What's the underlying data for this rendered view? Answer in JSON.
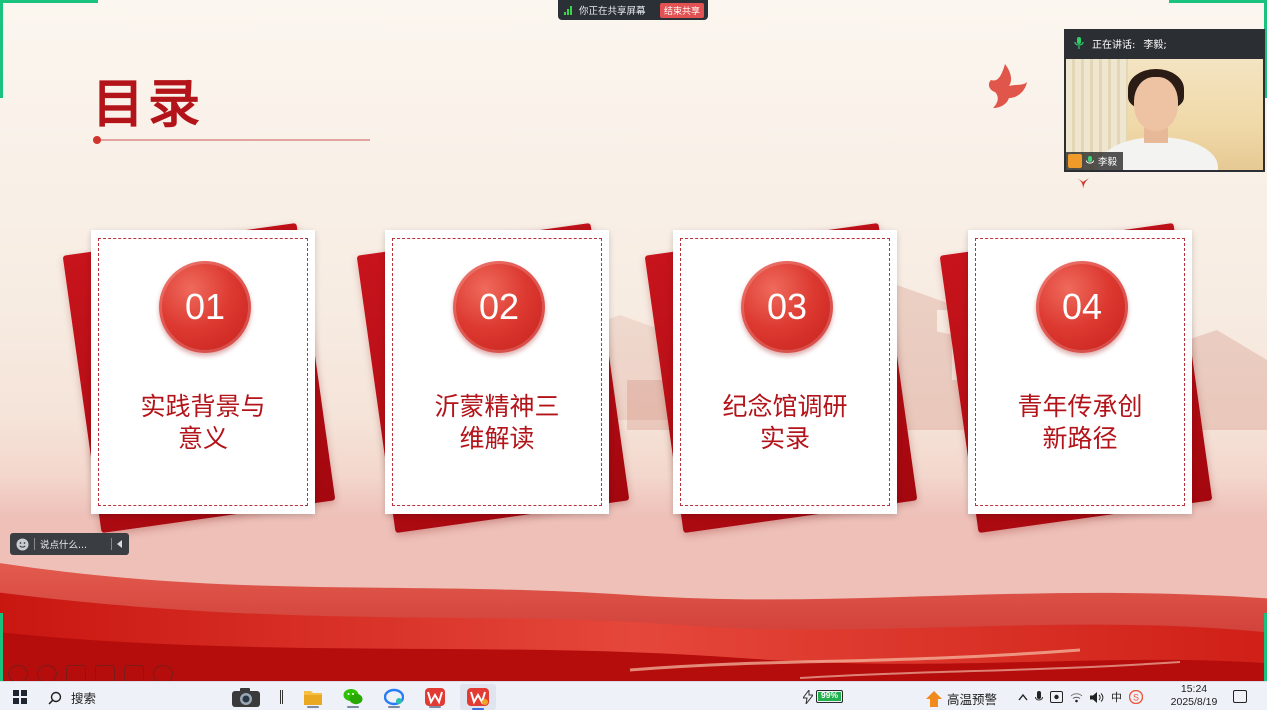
{
  "slide": {
    "title": "目录",
    "items": [
      {
        "number": "01",
        "line1": "实践背景与",
        "line2": "意义"
      },
      {
        "number": "02",
        "line1": "沂蒙精神三",
        "line2": "维解读"
      },
      {
        "number": "03",
        "line1": "纪念馆调研",
        "line2": "实录"
      },
      {
        "number": "04",
        "line1": "青年传承创",
        "line2": "新路径"
      }
    ]
  },
  "share_bar": {
    "status": "你正在共享屏幕",
    "stop_label": "结束共享"
  },
  "video": {
    "speaking_label": "正在讲话:",
    "speaker": "李毅;",
    "name": "李毅"
  },
  "comment": {
    "placeholder": "说点什么..."
  },
  "taskbar": {
    "search_label": "搜索",
    "battery": "99%",
    "battery_level": 0.99,
    "alert": "高温预警",
    "input_method": "中",
    "time": "15:24",
    "date": "2025/8/19"
  },
  "colors": {
    "accent": "#b3141a",
    "card_red": "#c8141c",
    "share_stop": "#e25252"
  }
}
